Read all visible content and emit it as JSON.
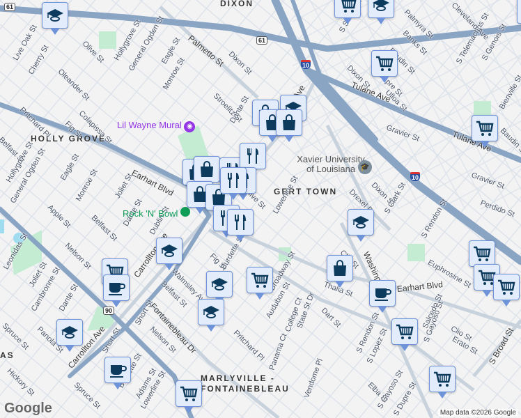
{
  "map": {
    "areas": [
      "DIXON",
      "HOLLY GROVE",
      "GERT TOWN",
      "MARLYVILLE -",
      "FONTAINEBLEAU",
      "AS"
    ],
    "major_roads": [
      "Palmetto St",
      "Earhart Blvd",
      "Tulane Ave",
      "Tulane Ave",
      "Carrollton Ave",
      "Carrollton Ave",
      "Carrollton Ave",
      "Washington Ave",
      "Earhart Blvd",
      "Fontainebleau Dr",
      "S Broad St"
    ],
    "streets": [
      "Olive St",
      "Hollygrove St",
      "General Ogden St",
      "Eagle St",
      "Monroe St",
      "Live Oak St",
      "Cherry St",
      "Oleander St",
      "Pritchard Pl",
      "Fig St",
      "Colapissa St",
      "Dixon St",
      "Stroelitz St",
      "Dante St",
      "Belfast St",
      "Hollygrove St",
      "General Ogden St",
      "Eagle St",
      "Monroe St",
      "Joliet St",
      "Apple St",
      "Belfast St",
      "Dante St",
      "Dublin St",
      "Olive St",
      "Nelson St",
      "Leonidas St",
      "Joliet St",
      "Cambronne St",
      "Dante St",
      "Spruce St",
      "Panola St",
      "Hickory St",
      "Short St",
      "Short St",
      "Nelson St",
      "Burdette St",
      "Adams St",
      "Lowerline St",
      "Spruce St",
      "Walmsley Ave",
      "Belfast St",
      "Fig St",
      "Burdette St",
      "Broadway St",
      "Pritchard Pl",
      "Audubon St",
      "College Ct",
      "State St Dr",
      "Panama Ct",
      "Dart St",
      "Vendome Pl",
      "Lowerline St",
      "Clio St",
      "Thalia St",
      "Dixon St",
      "Drexel Dr",
      "S Clark St",
      "Gravier St",
      "Gravier St",
      "Perdido St",
      "S Rendon St",
      "Euphrosine St",
      "S Rendon St",
      "S Lopez St",
      "Salcedo St",
      "S Gayoso St",
      "Clio St",
      "Erato St",
      "Elba St",
      "S Gayoso St",
      "S Dupre St",
      "Banks St",
      "Baudin St",
      "Palmyra St",
      "Ulloa St",
      "S Telemachus St",
      "S Genois St",
      "S Solomon St",
      "Cleveland Ave",
      "Baudin St",
      "Dixon St",
      "Dupre St",
      "Bienville St"
    ],
    "pois": [
      {
        "name": "Lil Wayne Mural",
        "color": "#9334e6",
        "icon": "camera-icon"
      },
      {
        "name": "Xavier University of Louisiana",
        "color": "#555555",
        "icon": "school-icon"
      },
      {
        "name": "Rock 'N' Bowl",
        "color": "#0f9d58",
        "icon": "bowling-icon"
      }
    ],
    "shields": {
      "us61": "61",
      "us90": "90",
      "i10": "10"
    },
    "attribution": "Map data ©2026 Google",
    "logo": "Google"
  },
  "markers": [
    {
      "type": "school"
    },
    {
      "type": "grocery"
    },
    {
      "type": "school"
    },
    {
      "type": "grocery"
    },
    {
      "type": "grocery"
    },
    {
      "type": "shopping"
    },
    {
      "type": "school"
    },
    {
      "type": "shopping"
    },
    {
      "type": "shopping"
    },
    {
      "type": "shopping"
    },
    {
      "type": "shopping"
    },
    {
      "type": "restaurant"
    },
    {
      "type": "restaurant"
    },
    {
      "type": "restaurant"
    },
    {
      "type": "shopping"
    },
    {
      "type": "shopping"
    },
    {
      "type": "restaurant"
    },
    {
      "type": "restaurant"
    },
    {
      "type": "restaurant"
    },
    {
      "type": "school"
    },
    {
      "type": "grocery"
    },
    {
      "type": "cafe"
    },
    {
      "type": "school"
    },
    {
      "type": "school"
    },
    {
      "type": "grocery"
    },
    {
      "type": "school"
    },
    {
      "type": "cafe"
    },
    {
      "type": "grocery"
    },
    {
      "type": "school"
    },
    {
      "type": "shopping"
    },
    {
      "type": "cafe"
    },
    {
      "type": "grocery"
    },
    {
      "type": "grocery"
    },
    {
      "type": "grocery"
    },
    {
      "type": "grocery"
    },
    {
      "type": "grocery"
    },
    {
      "type": "grocery"
    }
  ],
  "colors": {
    "highway": "#8aa4c4",
    "arterial": "#c8d2dd",
    "street": "#dde3ea",
    "park": "#c3ecd3",
    "water": "#9fdcf0",
    "marker_fill": "#e3ecfb",
    "marker_icon": "#0d3b5e"
  }
}
